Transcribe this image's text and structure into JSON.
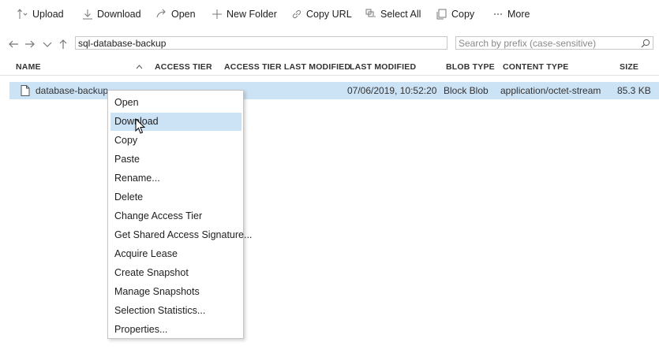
{
  "toolbar": {
    "upload": "Upload",
    "download": "Download",
    "open": "Open",
    "new_folder": "New Folder",
    "copy_url": "Copy URL",
    "select_all": "Select All",
    "copy": "Copy",
    "more": "More",
    "icons": [
      "upload-icon",
      "download-icon",
      "open-icon",
      "plus-icon",
      "link-icon",
      "select-all-icon",
      "copy-icon",
      "more-icon"
    ]
  },
  "address": {
    "path": "sql-database-backup",
    "search_placeholder": "Search by prefix (case-sensitive)"
  },
  "columns": {
    "name": "NAME",
    "access_tier": "ACCESS TIER",
    "access_tier_last_modified": "ACCESS TIER LAST MODIFIED",
    "last_modified": "LAST MODIFIED",
    "blob_type": "BLOB TYPE",
    "content_type": "CONTENT TYPE",
    "size": "SIZE"
  },
  "rows": [
    {
      "name": "database-backup.",
      "last_modified": "07/06/2019, 10:52:20",
      "blob_type": "Block Blob",
      "content_type": "application/octet-stream",
      "size": "85.3 KB"
    }
  ],
  "context_menu": {
    "items": [
      "Open",
      "Download",
      "Copy",
      "Paste",
      "Rename...",
      "Delete",
      "Change Access Tier",
      "Get Shared Access Signature...",
      "Acquire Lease",
      "Create Snapshot",
      "Manage Snapshots",
      "Selection Statistics...",
      "Properties..."
    ],
    "highlighted": "Download"
  },
  "colors": {
    "selection": "#cce2f5",
    "icon_gray": "#777777",
    "text": "#1e1e1e"
  }
}
